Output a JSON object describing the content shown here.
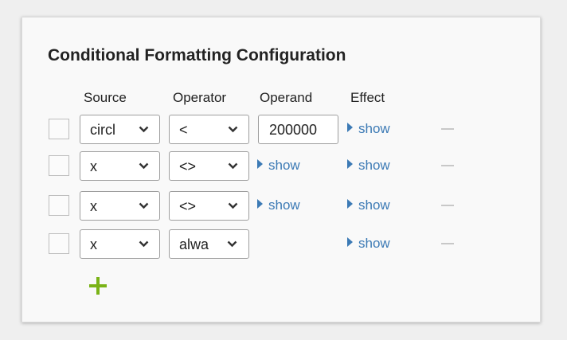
{
  "panel": {
    "title": "Conditional Formatting Configuration"
  },
  "columns": {
    "source": "Source",
    "operator": "Operator",
    "operand": "Operand",
    "effect": "Effect"
  },
  "rows": [
    {
      "checked": false,
      "source": "circl",
      "operator": "<",
      "operand": "200000",
      "effect_toggle": "show"
    },
    {
      "checked": false,
      "source": "x",
      "operator": "<>",
      "operand_toggle": "show",
      "effect_toggle": "show"
    },
    {
      "checked": false,
      "source": "x",
      "operator": "<>",
      "operand_toggle": "show",
      "effect_toggle": "show"
    },
    {
      "checked": false,
      "source": "x",
      "operator": "alwa",
      "effect_toggle": "show"
    }
  ],
  "colors": {
    "link": "#3c7ab5",
    "add": "#7ab317",
    "remove": "#c8c8c8"
  },
  "icons": {
    "toggle": "caret-right-icon",
    "dropdown": "chevron-down-icon",
    "add": "plus-icon",
    "remove": "minus-icon"
  }
}
